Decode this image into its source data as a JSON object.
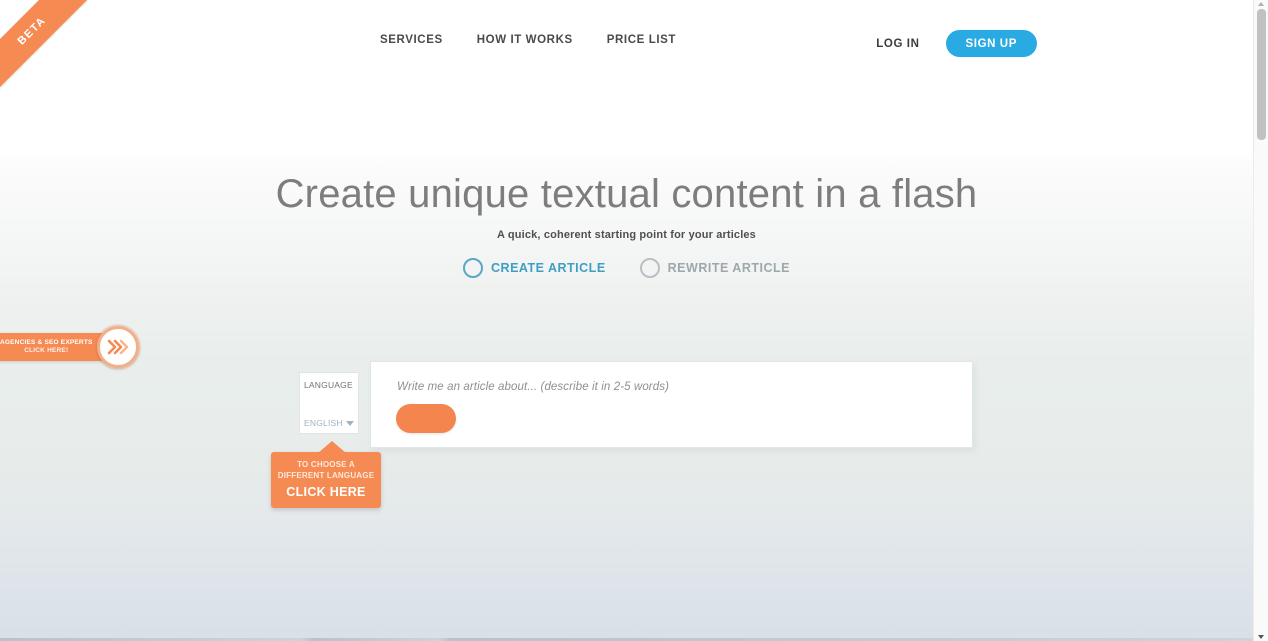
{
  "ribbon": {
    "label": "BETA"
  },
  "header": {
    "nav": [
      {
        "label": "SERVICES"
      },
      {
        "label": "HOW IT WORKS"
      },
      {
        "label": "PRICE LIST"
      }
    ],
    "login_label": "LOG IN",
    "signup_label": "SIGN UP",
    "accent_color": "#29aae3"
  },
  "hero": {
    "title": "Create unique textual content in a flash",
    "subtitle": "A quick, coherent starting point for your articles"
  },
  "modes": [
    {
      "label": "CREATE ARTICLE",
      "selected": true
    },
    {
      "label": "REWRITE ARTICLE",
      "selected": false
    }
  ],
  "side_tab": {
    "line1": "AGENCIES & SEO EXPERTS",
    "line2": "CLICK HERE!",
    "icon": "double-chevron-right-icon",
    "color": "#f58a53"
  },
  "language": {
    "title": "LANGUAGE",
    "value": "ENGLISH",
    "chevron": "chevron-down-icon"
  },
  "callout": {
    "line1": "TO CHOOSE A",
    "line2": "DIFFERENT LANGUAGE",
    "line3": "CLICK HERE",
    "color": "#f58a53"
  },
  "composer": {
    "placeholder": "Write me an article about... (describe it in 2-5 words)",
    "input_value": "",
    "submit_label": "",
    "submit_color": "#f5854f"
  },
  "scrollbar": {
    "up_arrow": "scroll-up-arrow-icon",
    "down_arrow": "scroll-down-arrow-icon"
  }
}
